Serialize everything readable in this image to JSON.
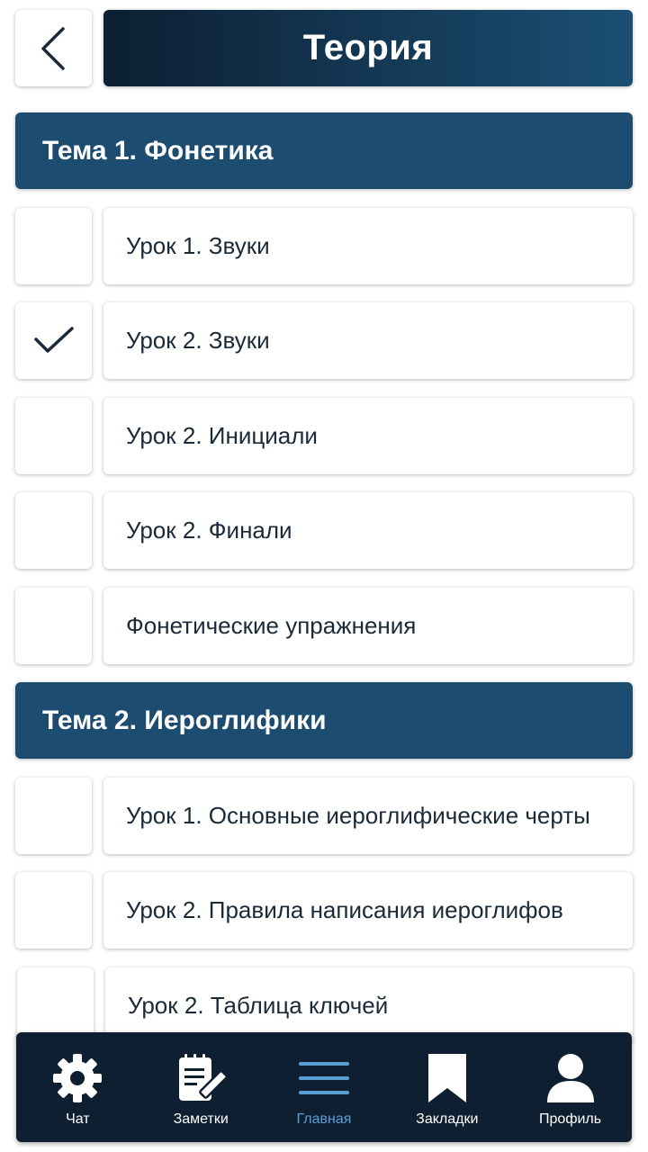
{
  "header": {
    "title": "Теория"
  },
  "sections": [
    {
      "title": "Тема 1. Фонетика",
      "lessons": [
        {
          "label": "Урок 1. Звуки",
          "completed": false
        },
        {
          "label": "Урок 2. Звуки",
          "completed": true
        },
        {
          "label": "Урок 2. Инициали",
          "completed": false
        },
        {
          "label": "Урок 2. Финали",
          "completed": false
        },
        {
          "label": "Фонетические упражнения",
          "completed": false
        }
      ]
    },
    {
      "title": "Тема 2. Иероглифики",
      "lessons": [
        {
          "label": "Урок 1. Основные иероглифические черты",
          "completed": false
        },
        {
          "label": "Урок 2. Правила написания иероглифов",
          "completed": false
        },
        {
          "label": "Урок 2. Таблица ключей",
          "completed": false
        }
      ]
    }
  ],
  "tabs": [
    {
      "label": "Чат",
      "icon": "gear-icon",
      "active": false
    },
    {
      "label": "Заметки",
      "icon": "notes-icon",
      "active": false
    },
    {
      "label": "Главная",
      "icon": "menu-icon",
      "active": true
    },
    {
      "label": "Закладки",
      "icon": "bookmark-icon",
      "active": false
    },
    {
      "label": "Профиль",
      "icon": "profile-icon",
      "active": false
    }
  ],
  "colors": {
    "header_gradient_start": "#0c1f33",
    "header_gradient_end": "#1b4f73",
    "section_bg": "#1c4c70",
    "tabbar_bg": "#0d1f30",
    "tab_active": "#5a9ed4"
  }
}
